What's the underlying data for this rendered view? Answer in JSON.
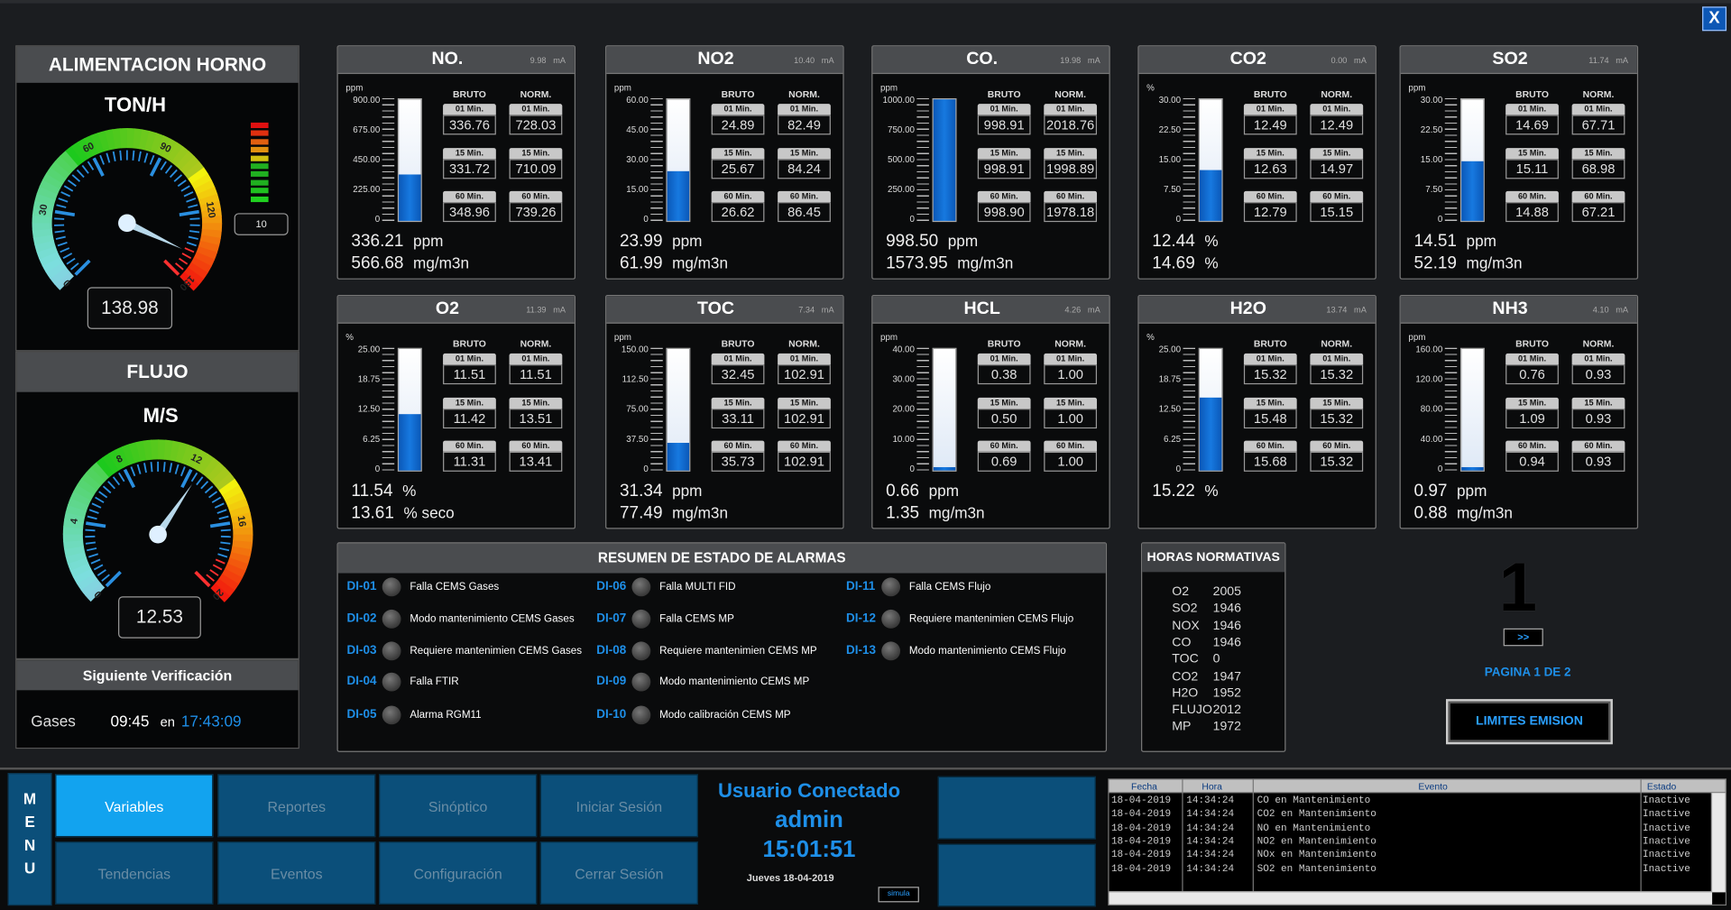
{
  "close_label": "X",
  "left": {
    "alim_title": "ALIMENTACION HORNO",
    "g1_unit": "TON/H",
    "g1_value": "138.98",
    "g1_level": "10",
    "g1_ticks": [
      "0",
      "30",
      "60",
      "90",
      "120",
      "150"
    ],
    "flujo_title": "FLUJO",
    "g2_unit": "M/S",
    "g2_value": "12.53",
    "g2_ticks": [
      "0",
      "4",
      "8",
      "12",
      "16",
      "20"
    ],
    "verif_title": "Siguiente Verificación",
    "verif_label": "Gases",
    "verif_time1": "09:45",
    "verif_en": "en",
    "verif_time2": "17:43:09"
  },
  "analyzers": [
    {
      "name": "NO.",
      "ma": "9.98",
      "maunit": "mA",
      "unit": "ppm",
      "ticks": [
        "900.00",
        "675.00",
        "450.00",
        "225.00",
        "0"
      ],
      "level": 0.38,
      "h_bruto": "BRUTO",
      "h_norm": "NORM.",
      "b1": "336.76",
      "n1": "728.03",
      "b15": "331.72",
      "n15": "710.09",
      "b60": "348.96",
      "n60": "739.26",
      "v1": "336.21",
      "u1": "ppm",
      "v2": "566.68",
      "u2": "mg/m3n"
    },
    {
      "name": "NO2",
      "ma": "10.40",
      "maunit": "mA",
      "unit": "ppm",
      "ticks": [
        "60.00",
        "45.00",
        "30.00",
        "15.00",
        "0"
      ],
      "level": 0.41,
      "h_bruto": "BRUTO",
      "h_norm": "NORM.",
      "b1": "24.89",
      "n1": "82.49",
      "b15": "25.67",
      "n15": "84.24",
      "b60": "26.62",
      "n60": "86.45",
      "v1": "23.99",
      "u1": "ppm",
      "v2": "61.99",
      "u2": "mg/m3n"
    },
    {
      "name": "CO.",
      "ma": "19.98",
      "maunit": "mA",
      "unit": "ppm",
      "ticks": [
        "1000.00",
        "750.00",
        "500.00",
        "250.00",
        "0"
      ],
      "level": 1.0,
      "h_bruto": "BRUTO",
      "h_norm": "NORM.",
      "b1": "998.91",
      "n1": "2018.76",
      "b15": "998.91",
      "n15": "1998.89",
      "b60": "998.90",
      "n60": "1978.18",
      "v1": "998.50",
      "u1": "ppm",
      "v2": "1573.95",
      "u2": "mg/m3n"
    },
    {
      "name": "CO2",
      "ma": "0.00",
      "maunit": "mA",
      "unit": "%",
      "ticks": [
        "30.00",
        "22.50",
        "15.00",
        "7.50",
        "0"
      ],
      "level": 0.42,
      "h_bruto": "BRUTO",
      "h_norm": "NORM.",
      "b1": "12.49",
      "n1": "12.49",
      "b15": "12.63",
      "n15": "14.97",
      "b60": "12.79",
      "n60": "15.15",
      "v1": "12.44",
      "u1": "%",
      "v2": "14.69",
      "u2": "%"
    },
    {
      "name": "SO2",
      "ma": "11.74",
      "maunit": "mA",
      "unit": "ppm",
      "ticks": [
        "30.00",
        "22.50",
        "15.00",
        "7.50",
        "0"
      ],
      "level": 0.49,
      "h_bruto": "BRUTO",
      "h_norm": "NORM.",
      "b1": "14.69",
      "n1": "67.71",
      "b15": "15.11",
      "n15": "68.98",
      "b60": "14.88",
      "n60": "67.21",
      "v1": "14.51",
      "u1": "ppm",
      "v2": "52.19",
      "u2": "mg/m3n"
    },
    {
      "name": "O2",
      "ma": "11.39",
      "maunit": "mA",
      "unit": "%",
      "ticks": [
        "25.00",
        "18.75",
        "12.50",
        "6.25",
        "0"
      ],
      "level": 0.46,
      "h_bruto": "BRUTO",
      "h_norm": "NORM.",
      "b1": "11.51",
      "n1": "11.51",
      "b15": "11.42",
      "n15": "13.51",
      "b60": "11.31",
      "n60": "13.41",
      "v1": "11.54",
      "u1": "%",
      "v2": "13.61",
      "u2": "% seco"
    },
    {
      "name": "TOC",
      "ma": "7.34",
      "maunit": "mA",
      "unit": "ppm",
      "ticks": [
        "150.00",
        "112.50",
        "75.00",
        "37.50",
        "0"
      ],
      "level": 0.23,
      "h_bruto": "BRUTO",
      "h_norm": "NORM.",
      "b1": "32.45",
      "n1": "102.91",
      "b15": "33.11",
      "n15": "102.91",
      "b60": "35.73",
      "n60": "102.91",
      "v1": "31.34",
      "u1": "ppm",
      "v2": "77.49",
      "u2": "mg/m3n"
    },
    {
      "name": "HCL",
      "ma": "4.26",
      "maunit": "mA",
      "unit": "ppm",
      "ticks": [
        "40.00",
        "30.00",
        "20.00",
        "10.00",
        "0"
      ],
      "level": 0.02,
      "h_bruto": "BRUTO",
      "h_norm": "NORM.",
      "b1": "0.38",
      "n1": "1.00",
      "b15": "0.50",
      "n15": "1.00",
      "b60": "0.69",
      "n60": "1.00",
      "v1": "0.66",
      "u1": "ppm",
      "v2": "1.35",
      "u2": "mg/m3n"
    },
    {
      "name": "H2O",
      "ma": "13.74",
      "maunit": "mA",
      "unit": "%",
      "ticks": [
        "25.00",
        "18.75",
        "12.50",
        "6.25",
        "0"
      ],
      "level": 0.6,
      "h_bruto": "BRUTO",
      "h_norm": "NORM.",
      "b1": "15.32",
      "n1": "15.32",
      "b15": "15.48",
      "n15": "15.32",
      "b60": "15.68",
      "n60": "15.32",
      "v1": "15.22",
      "u1": "%",
      "v2": "",
      "u2": ""
    },
    {
      "name": "NH3",
      "ma": "4.10",
      "maunit": "mA",
      "unit": "ppm",
      "ticks": [
        "160.00",
        "120.00",
        "80.00",
        "40.00",
        "0"
      ],
      "level": 0.01,
      "h_bruto": "BRUTO",
      "h_norm": "NORM.",
      "b1": "0.76",
      "n1": "0.93",
      "b15": "1.09",
      "n15": "0.93",
      "b60": "0.94",
      "n60": "0.93",
      "v1": "0.97",
      "u1": "ppm",
      "v2": "0.88",
      "u2": "mg/m3n"
    }
  ],
  "cell_labels": {
    "m1": "01 Min.",
    "m15": "15 Min.",
    "m60": "60 Min."
  },
  "alarms": {
    "title": "RESUMEN  DE ESTADO DE ALARMAS",
    "items": [
      {
        "id": "DI-01",
        "text": "Falla CEMS Gases"
      },
      {
        "id": "DI-02",
        "text": "Modo mantenimiento CEMS Gases"
      },
      {
        "id": "DI-03",
        "text": "Requiere mantenimien CEMS Gases"
      },
      {
        "id": "DI-04",
        "text": "Falla FTIR"
      },
      {
        "id": "DI-05",
        "text": "Alarma RGM11"
      },
      {
        "id": "DI-06",
        "text": "Falla MULTI FID"
      },
      {
        "id": "DI-07",
        "text": "Falla CEMS MP"
      },
      {
        "id": "DI-08",
        "text": "Requiere mantenimien CEMS MP"
      },
      {
        "id": "DI-09",
        "text": "Modo mantenimiento CEMS MP"
      },
      {
        "id": "DI-10",
        "text": "Modo calibración CEMS MP"
      },
      {
        "id": "DI-11",
        "text": "Falla CEMS Flujo"
      },
      {
        "id": "DI-12",
        "text": "Requiere mantenimien CEMS Flujo"
      },
      {
        "id": "DI-13",
        "text": "Modo mantenimiento CEMS Flujo"
      }
    ]
  },
  "horas": {
    "title": "HORAS NORMATIVAS",
    "rows": [
      [
        "O2",
        "2005"
      ],
      [
        "SO2",
        "1946"
      ],
      [
        "NOX",
        "1946"
      ],
      [
        "CO",
        "1946"
      ],
      [
        "TOC",
        "0"
      ],
      [
        "CO2",
        "1947"
      ],
      [
        "H2O",
        "1952"
      ],
      [
        "FLUJO",
        "2012"
      ],
      [
        "MP",
        "1972"
      ]
    ]
  },
  "page": {
    "number": "1",
    "next": ">>",
    "label": "PAGINA 1 DE 2",
    "limits": "LIMITES EMISION"
  },
  "menu": {
    "letters": [
      "M",
      "E",
      "N",
      "U"
    ]
  },
  "nav": [
    {
      "label": "Variables",
      "active": true
    },
    {
      "label": "Reportes"
    },
    {
      "label": "Sinóptico"
    },
    {
      "label": "Iniciar Sesión"
    },
    {
      "label": "Tendencias"
    },
    {
      "label": "Eventos"
    },
    {
      "label": "Configuración"
    },
    {
      "label": "Cerrar Sesión"
    }
  ],
  "user": {
    "title": "Usuario Conectado",
    "name": "admin",
    "time": "15:01:51",
    "date": "Jueves 18-04-2019",
    "simula": "simula"
  },
  "events": {
    "headers": [
      "Fecha",
      "Hora",
      "Evento",
      "Estado"
    ],
    "rows": [
      [
        "18-04-2019",
        "14:34:24",
        "CO en Mantenimiento",
        "Inactive"
      ],
      [
        "18-04-2019",
        "14:34:24",
        "CO2 en Mantenimiento",
        "Inactive"
      ],
      [
        "18-04-2019",
        "14:34:24",
        "NO en Mantenimiento",
        "Inactive"
      ],
      [
        "18-04-2019",
        "14:34:24",
        "NO2 en Mantenimiento",
        "Inactive"
      ],
      [
        "18-04-2019",
        "14:34:24",
        "NOx en Mantenimiento",
        "Inactive"
      ],
      [
        "18-04-2019",
        "14:34:24",
        "SO2 en Mantenimiento",
        "Inactive"
      ]
    ]
  }
}
